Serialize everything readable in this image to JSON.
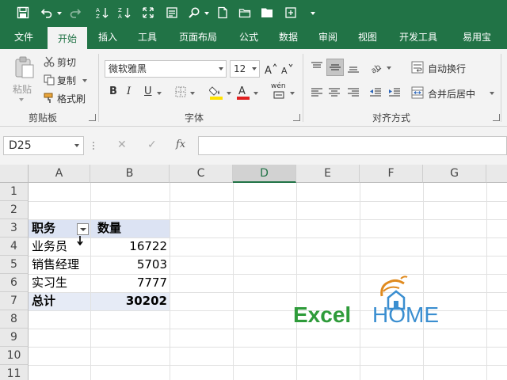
{
  "tabs": [
    "文件",
    "开始",
    "插入",
    "工具",
    "页面布局",
    "公式",
    "数据",
    "审阅",
    "视图",
    "开发工具",
    "易用宝"
  ],
  "active_tab": "开始",
  "ribbon": {
    "clipboard": {
      "paste_label": "粘贴",
      "cut_label": "剪切",
      "copy_label": "复制",
      "format_painter_label": "格式刷",
      "group_label": "剪贴板"
    },
    "font": {
      "font_name": "微软雅黑",
      "font_size": "12",
      "bold": "B",
      "italic": "I",
      "underline": "U",
      "phonetic": "wén",
      "group_label": "字体",
      "font_color": "#e02020",
      "fill_color": "#ffe200"
    },
    "alignment": {
      "wrap_text_label": "自动换行",
      "merge_center_label": "合并后居中",
      "group_label": "对齐方式"
    }
  },
  "formula_bar": {
    "name_box": "D25",
    "cancel_icon": "✕",
    "enter_icon": "✓",
    "fx_label": "fx",
    "formula": ""
  },
  "sheet": {
    "columns": [
      "A",
      "B",
      "C",
      "D",
      "E",
      "F",
      "G"
    ],
    "selected_column": "D",
    "rows": [
      "1",
      "2",
      "3",
      "4",
      "5",
      "6",
      "7",
      "8",
      "9",
      "10",
      "11"
    ],
    "pivot": {
      "header": {
        "field": "职务",
        "value": "数量"
      },
      "items": [
        {
          "label": "业务员",
          "value": "16722"
        },
        {
          "label": "销售经理",
          "value": "5703"
        },
        {
          "label": "实习生",
          "value": "7777"
        }
      ],
      "total": {
        "label": "总计",
        "value": "30202"
      }
    }
  },
  "watermark": {
    "text_excel": "Excel",
    "text_home": "HOME",
    "excel_color": "#2e9b3a",
    "home_color": "#3a8ed0"
  }
}
